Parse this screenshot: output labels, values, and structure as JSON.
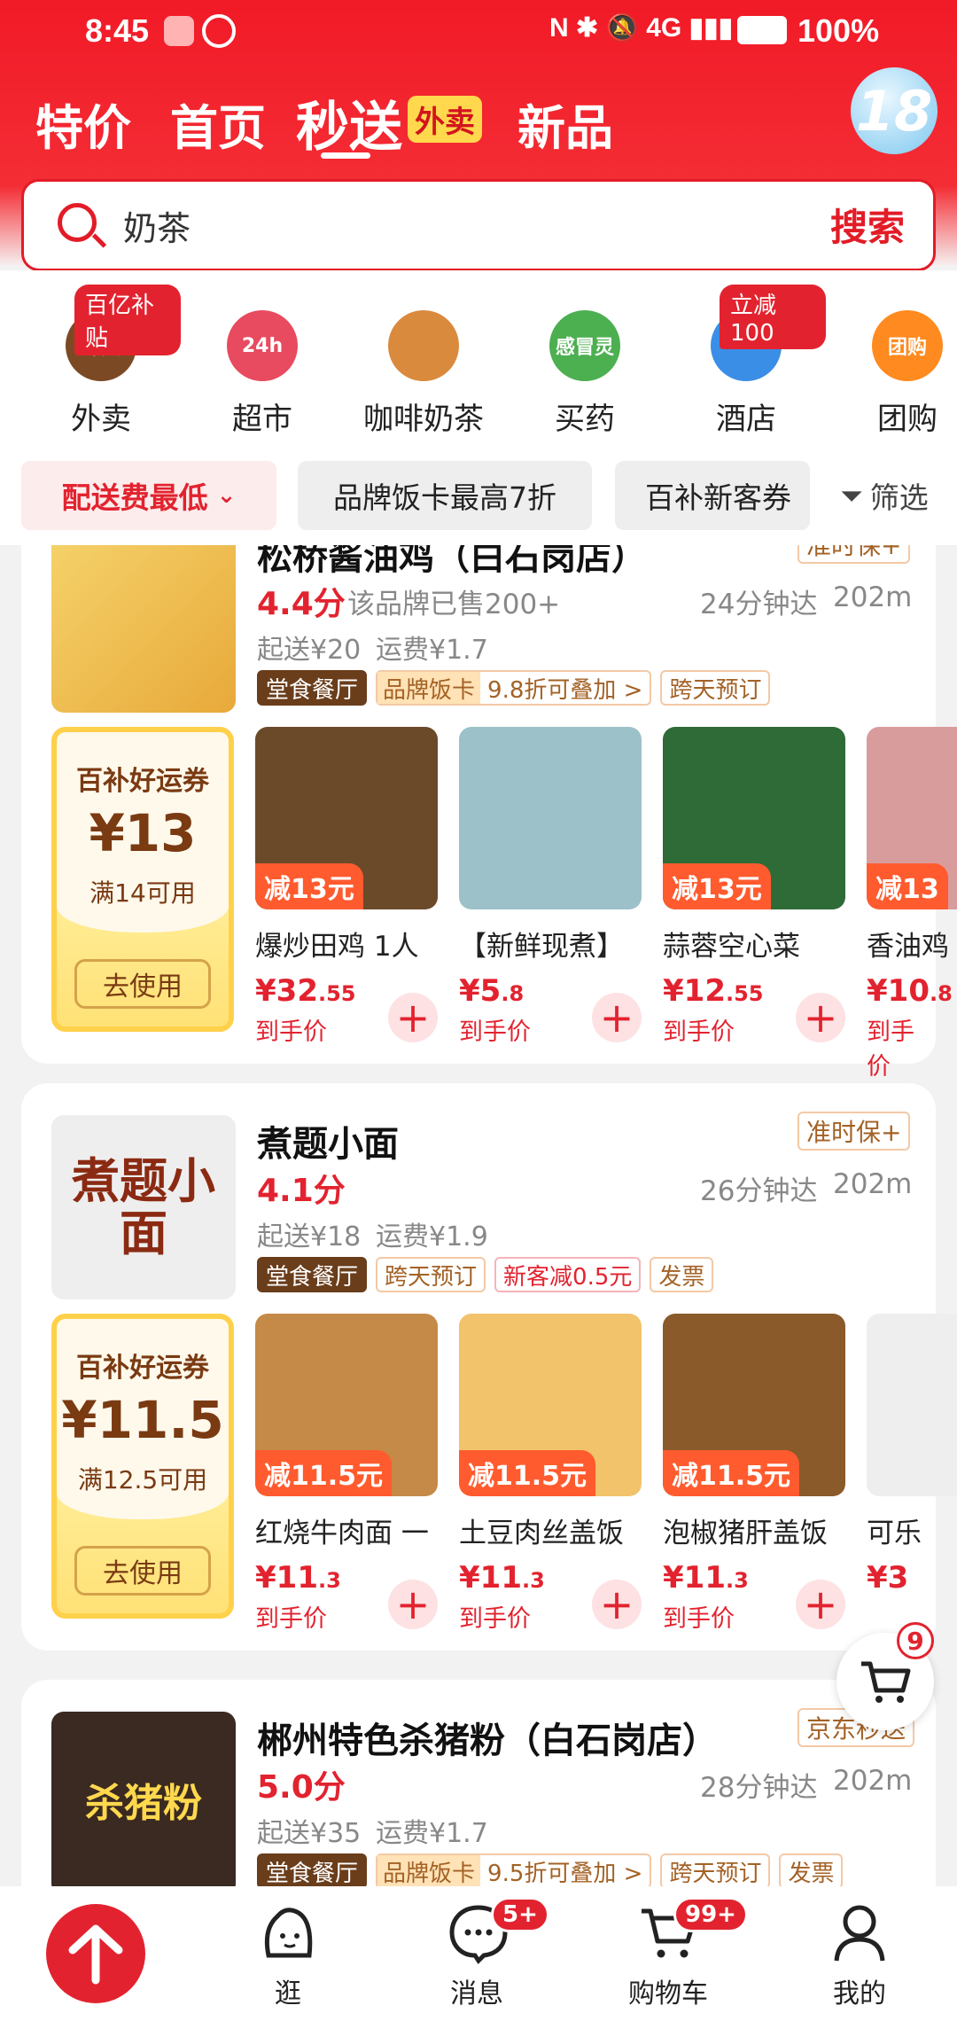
{
  "status_bar": {
    "time": "8:45",
    "battery": "100%",
    "network": "4G"
  },
  "nav_tabs": [
    {
      "label": "特价"
    },
    {
      "label": "首页"
    },
    {
      "label": "秒送",
      "badge": "外卖",
      "active": true
    },
    {
      "label": "新品"
    }
  ],
  "promo_badge": "18",
  "search": {
    "value": "奶茶",
    "button": "搜索"
  },
  "categories": [
    {
      "label": "外卖",
      "badge": "百亿补贴",
      "icon": "takeout-icon",
      "icon_text": "外卖",
      "color": "#7b4a24"
    },
    {
      "label": "超市",
      "icon": "supermarket-icon",
      "icon_text": "24h",
      "color": "#e84a5f"
    },
    {
      "label": "咖啡奶茶",
      "icon": "coffee-cup-icon",
      "icon_text": "",
      "color": "#d98a3d"
    },
    {
      "label": "买药",
      "icon": "medicine-icon",
      "icon_text": "感冒灵",
      "color": "#4caf50"
    },
    {
      "label": "酒店",
      "badge": "立减100",
      "icon": "hotel-icon",
      "icon_text": "",
      "color": "#3a8ee6"
    },
    {
      "label": "团购",
      "icon": "group-buy-icon",
      "icon_text": "团购",
      "color": "#ff8a1f"
    }
  ],
  "filters": {
    "chips": [
      "配送费最低",
      "品牌饭卡最高7折",
      "百补新客券"
    ],
    "filter_label": "筛选"
  },
  "stores": [
    {
      "name": "松桥酱油鸡（白石岗店）",
      "guarantee": "准时保+",
      "rating": "4.4分",
      "sales": "该品牌已售200+",
      "eta": "24分钟达",
      "distance": "202m",
      "min_order": "起送¥20",
      "delivery_fee": "运费¥1.7",
      "tags": [
        {
          "text": "堂食餐厅",
          "style": "dark"
        },
        {
          "text": "品牌饭卡",
          "style": "brand",
          "extra": "9.8折可叠加 >"
        },
        {
          "text": "跨天预订",
          "style": "normal"
        }
      ],
      "coupon": {
        "title": "百补好运券",
        "value": "¥13",
        "condition": "满14可用",
        "button": "去使用"
      },
      "items": [
        {
          "name": "爆炒田鸡 1人",
          "discount": "减13元",
          "price_main": "¥32",
          "price_dec": ".55",
          "price_label": "到手价"
        },
        {
          "name": "【新鲜现煮】",
          "discount": "",
          "price_main": "¥5",
          "price_dec": ".8",
          "price_label": "到手价"
        },
        {
          "name": "蒜蓉空心菜",
          "discount": "减13元",
          "price_main": "¥12",
          "price_dec": ".55",
          "price_label": "到手价"
        },
        {
          "name": "香油鸡",
          "discount": "减13",
          "price_main": "¥10",
          "price_dec": ".8",
          "price_label": "到手价"
        }
      ]
    },
    {
      "name": "煮题小面",
      "guarantee": "准时保+",
      "rating": "4.1分",
      "sales": "",
      "eta": "26分钟达",
      "distance": "202m",
      "min_order": "起送¥18",
      "delivery_fee": "运费¥1.9",
      "logo_text": "煮题小面",
      "tags": [
        {
          "text": "堂食餐厅",
          "style": "dark"
        },
        {
          "text": "跨天预订",
          "style": "normal"
        },
        {
          "text": "新客减0.5元",
          "style": "red"
        },
        {
          "text": "发票",
          "style": "normal"
        }
      ],
      "coupon": {
        "title": "百补好运券",
        "value": "¥11.5",
        "condition": "满12.5可用",
        "button": "去使用"
      },
      "items": [
        {
          "name": "红烧牛肉面 一",
          "discount": "减11.5元",
          "price_main": "¥11",
          "price_dec": ".3",
          "price_label": "到手价"
        },
        {
          "name": "土豆肉丝盖饭",
          "discount": "减11.5元",
          "price_main": "¥11",
          "price_dec": ".3",
          "price_label": "到手价"
        },
        {
          "name": "泡椒猪肝盖饭",
          "discount": "减11.5元",
          "price_main": "¥11",
          "price_dec": ".3",
          "price_label": "到手价"
        },
        {
          "name": "可乐",
          "discount": "",
          "price_main": "¥3",
          "price_dec": "",
          "price_label": ""
        }
      ]
    },
    {
      "name": "郴州特色杀猪粉（白石岗店）",
      "guarantee": "京东秒送",
      "rating": "5.0分",
      "sales": "",
      "eta": "28分钟达",
      "distance": "202m",
      "min_order": "起送¥35",
      "delivery_fee": "运费¥1.7",
      "logo_text": "杀猪粉",
      "tags": [
        {
          "text": "堂食餐厅",
          "style": "dark"
        },
        {
          "text": "品牌饭卡",
          "style": "brand",
          "extra": "9.5折可叠加 >"
        },
        {
          "text": "跨天预订",
          "style": "normal"
        },
        {
          "text": "发票",
          "style": "normal"
        }
      ]
    }
  ],
  "cart_float": {
    "count": "9"
  },
  "bottom_nav": [
    {
      "label": "",
      "icon": "scroll-to-top-icon"
    },
    {
      "label": "逛",
      "icon": "browse-mascot-icon"
    },
    {
      "label": "消息",
      "icon": "message-icon",
      "badge": "5+"
    },
    {
      "label": "购物车",
      "icon": "cart-icon",
      "badge": "99+"
    },
    {
      "label": "我的",
      "icon": "profile-icon"
    }
  ],
  "colors": {
    "brand_red": "#e2232f",
    "header_red": "#f11a27",
    "coupon_gold": "#ffd04a"
  }
}
